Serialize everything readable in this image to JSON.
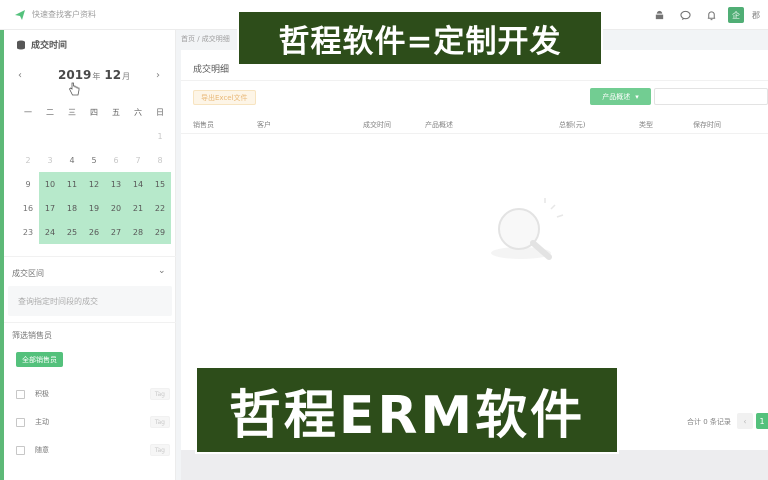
{
  "topbar": {
    "brand_text": "快速查找客户资料",
    "avatar_text": "企",
    "user_text": "郡"
  },
  "sidebar": {
    "title": "成交时间",
    "calendar": {
      "year": "2019",
      "year_unit": "年",
      "month": "12",
      "month_unit": "月",
      "prev": "‹",
      "next": "›",
      "weekdays": [
        "一",
        "二",
        "三",
        "四",
        "五",
        "六",
        "日"
      ],
      "rows": [
        [
          "",
          "",
          "",
          "",
          "",
          "",
          "1"
        ],
        [
          "2",
          "3",
          "4",
          "5",
          "6",
          "7",
          "8"
        ],
        [
          "9",
          "10",
          "11",
          "12",
          "13",
          "14",
          "15"
        ],
        [
          "16",
          "17",
          "18",
          "19",
          "20",
          "21",
          "22"
        ],
        [
          "23",
          "24",
          "25",
          "26",
          "27",
          "28",
          "29"
        ]
      ]
    },
    "range_title": "成交区间",
    "range_placeholder": "查询指定时间段的成交",
    "sales_title": "筛选销售员",
    "all_sales_button": "全部销售员",
    "reps": [
      {
        "name": "积极",
        "tag": "Tag"
      },
      {
        "name": "主动",
        "tag": "Tag"
      },
      {
        "name": "随意",
        "tag": "Tag"
      }
    ]
  },
  "main": {
    "breadcrumb": "首页 / 成交明细",
    "panel_title": "成交明细",
    "export_button": "导出Excel文件",
    "product_select": "产品概述",
    "columns": [
      "销售员",
      "客户",
      "成交时间",
      "产品概述",
      "总额(元)",
      "类型",
      "保存时间"
    ],
    "total_text": "合计 0 条记录",
    "page_prev": "‹",
    "page_current": "1"
  },
  "overlays": {
    "top_banner": "哲程软件=定制开发",
    "bottom_banner": "哲程ERM软件"
  },
  "colors": {
    "accent_green": "#2fb460",
    "highlight": "#a8e4c0",
    "banner_bg": "#2d4d1a"
  }
}
